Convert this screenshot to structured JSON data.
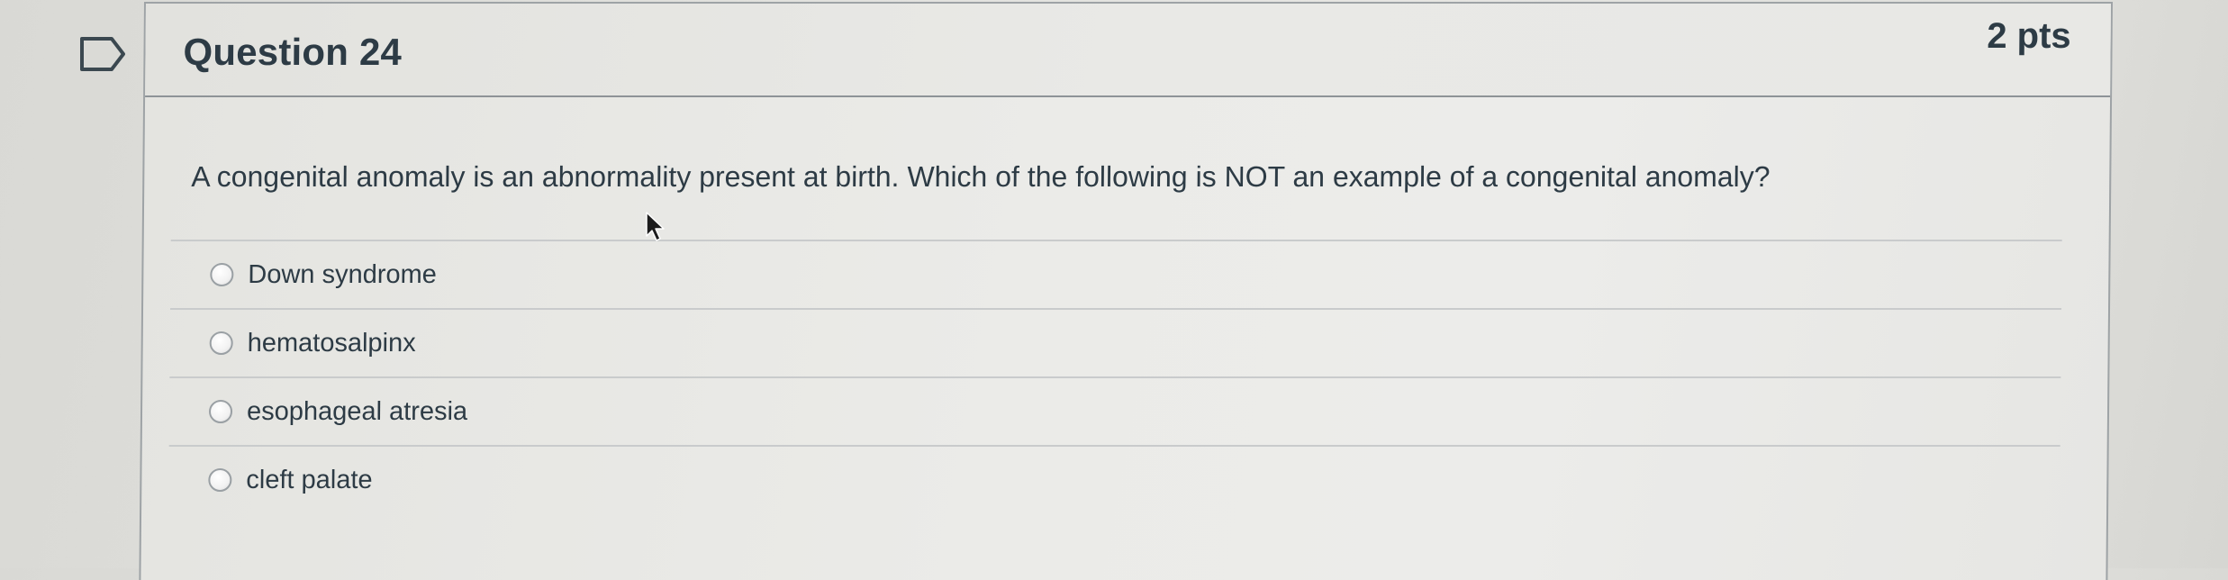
{
  "question": {
    "title": "Question 24",
    "points": "2 pts",
    "text": "A congenital anomaly is an abnormality present at birth. Which of the following is NOT an example of a congenital anomaly?",
    "answers": [
      {
        "label": "Down syndrome"
      },
      {
        "label": "hematosalpinx"
      },
      {
        "label": "esophageal atresia"
      },
      {
        "label": "cleft palate"
      }
    ]
  },
  "icons": {
    "flag": "flag-icon",
    "radio": "radio-button",
    "cursor": "mouse-pointer-icon"
  },
  "colors": {
    "text": "#2d3b45",
    "border": "#9ea3a6",
    "background": "#e6e6e3"
  }
}
